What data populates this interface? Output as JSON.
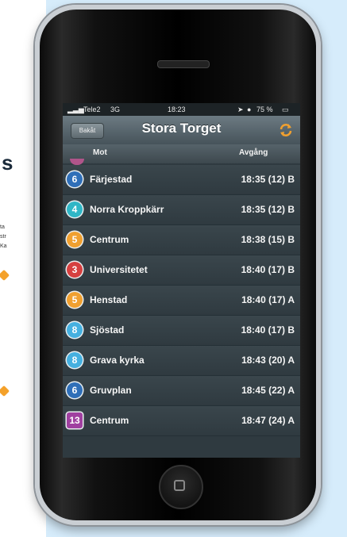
{
  "status_bar": {
    "carrier": "Tele2",
    "network": "3G",
    "time": "18:23",
    "battery": "75 %"
  },
  "nav": {
    "back_label": "Bakåt",
    "title": "Stora Torget"
  },
  "columns": {
    "destination": "Mot",
    "departure": "Avgång"
  },
  "colors": {
    "line_6": "#2f6fb8",
    "line_4": "#2fb6c6",
    "line_5": "#f0a030",
    "line_3": "#d64040",
    "line_8": "#45b0e0",
    "line_13": "#a040a0"
  },
  "departures": [
    {
      "line": "6",
      "destination": "Färjestad",
      "departure": "18:35 (12) B",
      "color": "#2f6fb8"
    },
    {
      "line": "4",
      "destination": "Norra Kroppkärr",
      "departure": "18:35 (12) B",
      "color": "#2fb6c6"
    },
    {
      "line": "5",
      "destination": "Centrum",
      "departure": "18:38 (15) B",
      "color": "#f0a030"
    },
    {
      "line": "3",
      "destination": "Universitetet",
      "departure": "18:40 (17) B",
      "color": "#d64040"
    },
    {
      "line": "5",
      "destination": "Henstad",
      "departure": "18:40 (17) A",
      "color": "#f0a030"
    },
    {
      "line": "8",
      "destination": "Sjöstad",
      "departure": "18:40 (17) B",
      "color": "#45b0e0"
    },
    {
      "line": "8",
      "destination": "Grava kyrka",
      "departure": "18:43 (20) A",
      "color": "#45b0e0"
    },
    {
      "line": "6",
      "destination": "Gruvplan",
      "departure": "18:45 (22) A",
      "color": "#2f6fb8"
    },
    {
      "line": "13",
      "destination": "Centrum",
      "departure": "18:47 (24) A",
      "color": "#a040a0",
      "square": true
    }
  ],
  "left_page": {
    "heading": "s",
    "fragments": [
      "ta",
      "str",
      "Ka"
    ]
  }
}
